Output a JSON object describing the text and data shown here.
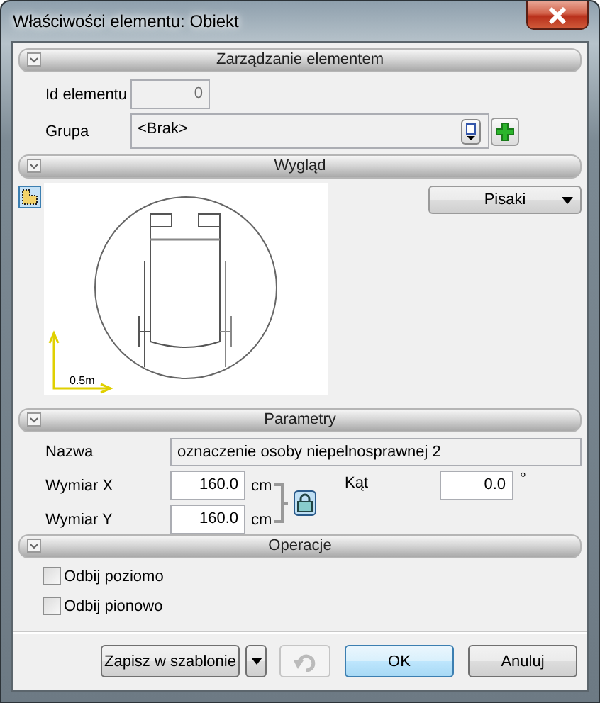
{
  "window": {
    "title": "Właściwości elementu: Obiekt"
  },
  "management": {
    "header": "Zarządzanie elementem",
    "id_label": "Id elementu",
    "id_value": "0",
    "group_label": "Grupa",
    "group_value": "<Brak>"
  },
  "appearance": {
    "header": "Wygląd",
    "pens_button": "Pisaki",
    "scale_label": "0.5m"
  },
  "parameters": {
    "header": "Parametry",
    "name_label": "Nazwa",
    "name_value": "oznaczenie osoby niepelnosprawnej 2",
    "x_label": "Wymiar X",
    "x_value": "160.0",
    "x_unit": "cm",
    "y_label": "Wymiar Y",
    "y_value": "160.0",
    "y_unit": "cm",
    "angle_label": "Kąt",
    "angle_value": "0.0",
    "angle_unit": "°"
  },
  "operations": {
    "header": "Operacje",
    "options": [
      {
        "label": "Odbij poziomo",
        "checked": false
      },
      {
        "label": "Odbij pionowo",
        "checked": false
      }
    ]
  },
  "footer": {
    "save_template": "Zapisz w szablonie",
    "undo": {
      "disabled": true
    },
    "ok": "OK",
    "cancel": "Anuluj"
  }
}
